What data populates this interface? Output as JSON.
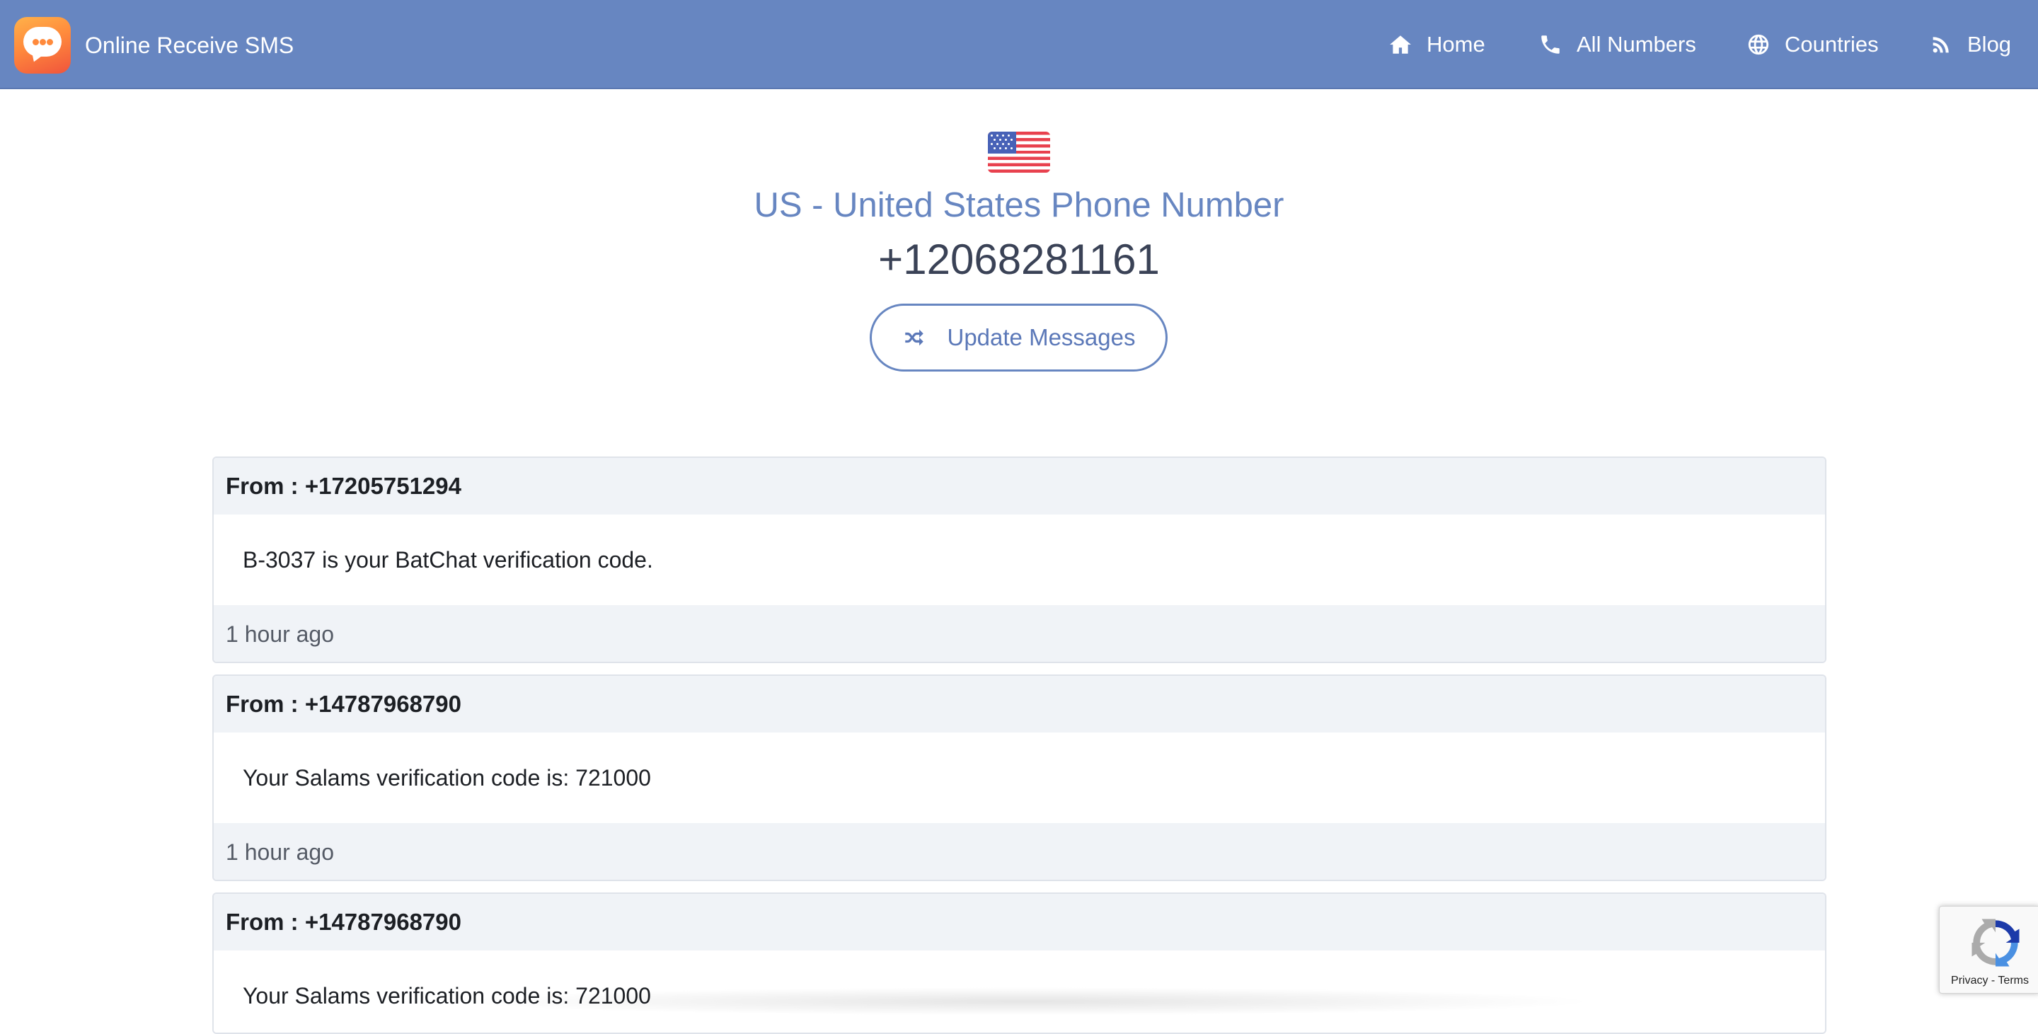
{
  "navbar": {
    "brand": "Online Receive SMS",
    "items": [
      {
        "label": "Home",
        "icon": "home-icon"
      },
      {
        "label": "All Numbers",
        "icon": "phone-icon"
      },
      {
        "label": "Countries",
        "icon": "globe-icon"
      },
      {
        "label": "Blog",
        "icon": "rss-icon"
      }
    ],
    "color": "#6786c1"
  },
  "header": {
    "flag": "us-flag-icon",
    "title": "US - United States Phone Number",
    "number": "+12068281161",
    "update_button": "Update Messages",
    "update_icon": "shuffle-icon"
  },
  "messages": [
    {
      "from": "From : +17205751294",
      "text": "B-3037 is your BatChat verification code.",
      "time": "1 hour ago"
    },
    {
      "from": "From : +14787968790",
      "text": "Your Salams verification code is: 721000",
      "time": "1 hour ago"
    },
    {
      "from": "From : +14787968790",
      "text": "Your Salams verification code is: 721000",
      "time": ""
    }
  ],
  "recaptcha": {
    "links": "Privacy - Terms"
  }
}
